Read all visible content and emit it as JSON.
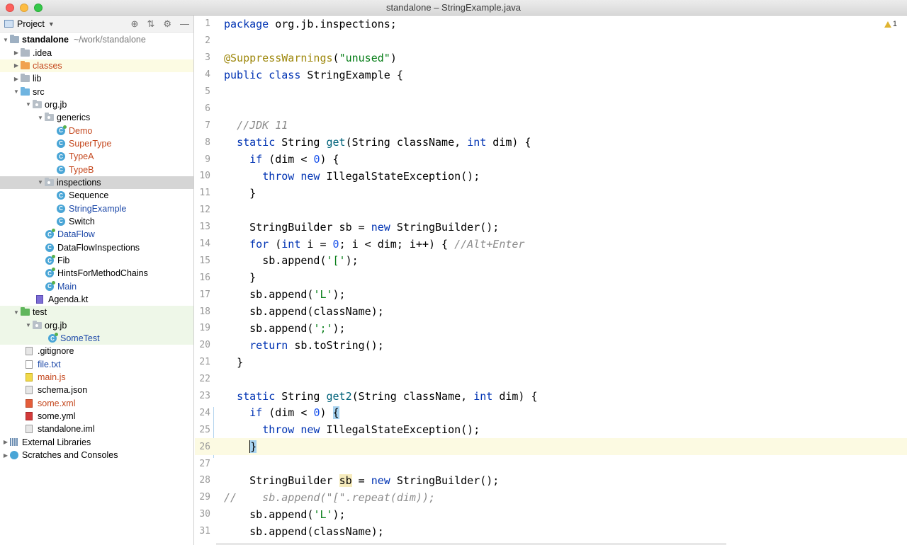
{
  "window": {
    "title": "standalone – StringExample.java"
  },
  "project_panel": {
    "label": "Project",
    "tools": {
      "locate": "⊕",
      "collapse": "⇅",
      "settings": "⚙",
      "hide": "—"
    },
    "tree": [
      {
        "label": "standalone",
        "hint": "~/work/standalone",
        "depth": 0,
        "arrow": "down",
        "icon": "module"
      },
      {
        "label": ".idea",
        "depth": 1,
        "arrow": "right",
        "icon": "folder"
      },
      {
        "label": "classes",
        "depth": 1,
        "arrow": "right",
        "icon": "folder-orange"
      },
      {
        "label": "lib",
        "depth": 1,
        "arrow": "right",
        "icon": "folder"
      },
      {
        "label": "src",
        "depth": 1,
        "arrow": "down",
        "icon": "folder-blue"
      },
      {
        "label": "org.jb",
        "depth": 2,
        "arrow": "down",
        "icon": "package"
      },
      {
        "label": "generics",
        "depth": 3,
        "arrow": "down",
        "icon": "package"
      },
      {
        "label": "Demo",
        "depth": 4,
        "icon": "class-runnable"
      },
      {
        "label": "SuperType",
        "depth": 4,
        "icon": "class"
      },
      {
        "label": "TypeA",
        "depth": 4,
        "icon": "class"
      },
      {
        "label": "TypeB",
        "depth": 4,
        "icon": "class"
      },
      {
        "label": "inspections",
        "depth": 3,
        "arrow": "down",
        "icon": "package"
      },
      {
        "label": "Sequence",
        "depth": 4,
        "icon": "class"
      },
      {
        "label": "StringExample",
        "depth": 4,
        "icon": "class"
      },
      {
        "label": "Switch",
        "depth": 4,
        "icon": "class"
      },
      {
        "label": "DataFlow",
        "depth": 3,
        "icon": "class-runnable"
      },
      {
        "label": "DataFlowInspections",
        "depth": 3,
        "icon": "class"
      },
      {
        "label": "Fib",
        "depth": 3,
        "icon": "class-runnable"
      },
      {
        "label": "HintsForMethodChains",
        "depth": 3,
        "icon": "class-runnable"
      },
      {
        "label": "Main",
        "depth": 3,
        "icon": "class-runnable"
      },
      {
        "label": "Agenda.kt",
        "depth": 2,
        "icon": "file-kt"
      },
      {
        "label": "test",
        "depth": 1,
        "arrow": "down",
        "icon": "folder-green"
      },
      {
        "label": "org.jb",
        "depth": 2,
        "arrow": "down",
        "icon": "package"
      },
      {
        "label": "SomeTest",
        "depth": 3,
        "icon": "class-runnable"
      },
      {
        "label": ".gitignore",
        "depth": 1,
        "icon": "file"
      },
      {
        "label": "file.txt",
        "depth": 1,
        "icon": "file-txt"
      },
      {
        "label": "main.js",
        "depth": 1,
        "icon": "file-js"
      },
      {
        "label": "schema.json",
        "depth": 1,
        "icon": "file"
      },
      {
        "label": "some.xml",
        "depth": 1,
        "icon": "file-xml"
      },
      {
        "label": "some.yml",
        "depth": 1,
        "icon": "file-yml"
      },
      {
        "label": "standalone.iml",
        "depth": 1,
        "icon": "file"
      },
      {
        "label": "External Libraries",
        "depth": 0,
        "arrow": "right",
        "icon": "library"
      },
      {
        "label": "Scratches and Consoles",
        "depth": 0,
        "arrow": "right",
        "icon": "scratch"
      }
    ]
  },
  "editor": {
    "warnings": {
      "count": "1"
    },
    "line_numbers": [
      "1",
      "2",
      "3",
      "4",
      "5",
      "6",
      "7",
      "8",
      "9",
      "10",
      "11",
      "12",
      "13",
      "14",
      "15",
      "16",
      "17",
      "18",
      "19",
      "20",
      "21",
      "22",
      "23",
      "24",
      "25",
      "26",
      "27",
      "28",
      "29",
      "30",
      "31"
    ],
    "code": {
      "l1": {
        "kw": "package",
        "rest": " org.jb.inspections;"
      },
      "l3": {
        "annotation": "@SuppressWarnings",
        "open": "(",
        "str": "\"unused\"",
        "close": ")"
      },
      "l4": {
        "kw1": "public",
        "kw2": "class",
        "rest": " StringExample {"
      },
      "l7": {
        "comment": "//JDK 11"
      },
      "l8": {
        "kw": "static",
        "t1": " String ",
        "fn": "get",
        "t2": "(String className, ",
        "kw2": "int",
        "t3": " dim) {"
      },
      "l9": {
        "kw": "if",
        "t1": " (dim < ",
        "num": "0",
        "t2": ") {"
      },
      "l10": {
        "kw1": "throw",
        "kw2": "new",
        "rest": " IllegalStateException();"
      },
      "l11": {
        "text": "}"
      },
      "l13": {
        "t1": "StringBuilder sb = ",
        "kw": "new",
        "t2": " StringBuilder();"
      },
      "l14": {
        "kw": "for",
        "t1": " (",
        "kw2": "int",
        "t2": " i = ",
        "num": "0",
        "t3": "; i < dim; i++) { ",
        "comment": "//Alt+Enter"
      },
      "l15": {
        "t1": "sb.append(",
        "str": "'['",
        "t2": ");"
      },
      "l16": {
        "text": "}"
      },
      "l17": {
        "t1": "sb.append(",
        "str": "'L'",
        "t2": ");"
      },
      "l18": {
        "text": "sb.append(className);"
      },
      "l19": {
        "t1": "sb.append(",
        "str": "';'",
        "t2": ");"
      },
      "l20": {
        "kw": "return",
        "rest": " sb.toString();"
      },
      "l21": {
        "text": "}"
      },
      "l23": {
        "kw": "static",
        "t1": " String ",
        "fn": "get2",
        "t2": "(String className, ",
        "kw2": "int",
        "t3": " dim) {"
      },
      "l24": {
        "kw": "if",
        "t1": " (dim < ",
        "num": "0",
        "t2": ") ",
        "brace": "{"
      },
      "l25": {
        "kw1": "throw",
        "kw2": "new",
        "rest": " IllegalStateException();"
      },
      "l26": {
        "brace": "}"
      },
      "l28": {
        "t1": "StringBuilder ",
        "hl": "sb",
        "t2": " = ",
        "kw": "new",
        "t3": " StringBuilder();"
      },
      "l29": {
        "comment": "//    sb.append(\"[\".repeat(dim));"
      },
      "l30": {
        "t1": "sb.append(",
        "str": "'L'",
        "t2": ");"
      },
      "l31": {
        "text": "sb.append(className);"
      }
    }
  }
}
